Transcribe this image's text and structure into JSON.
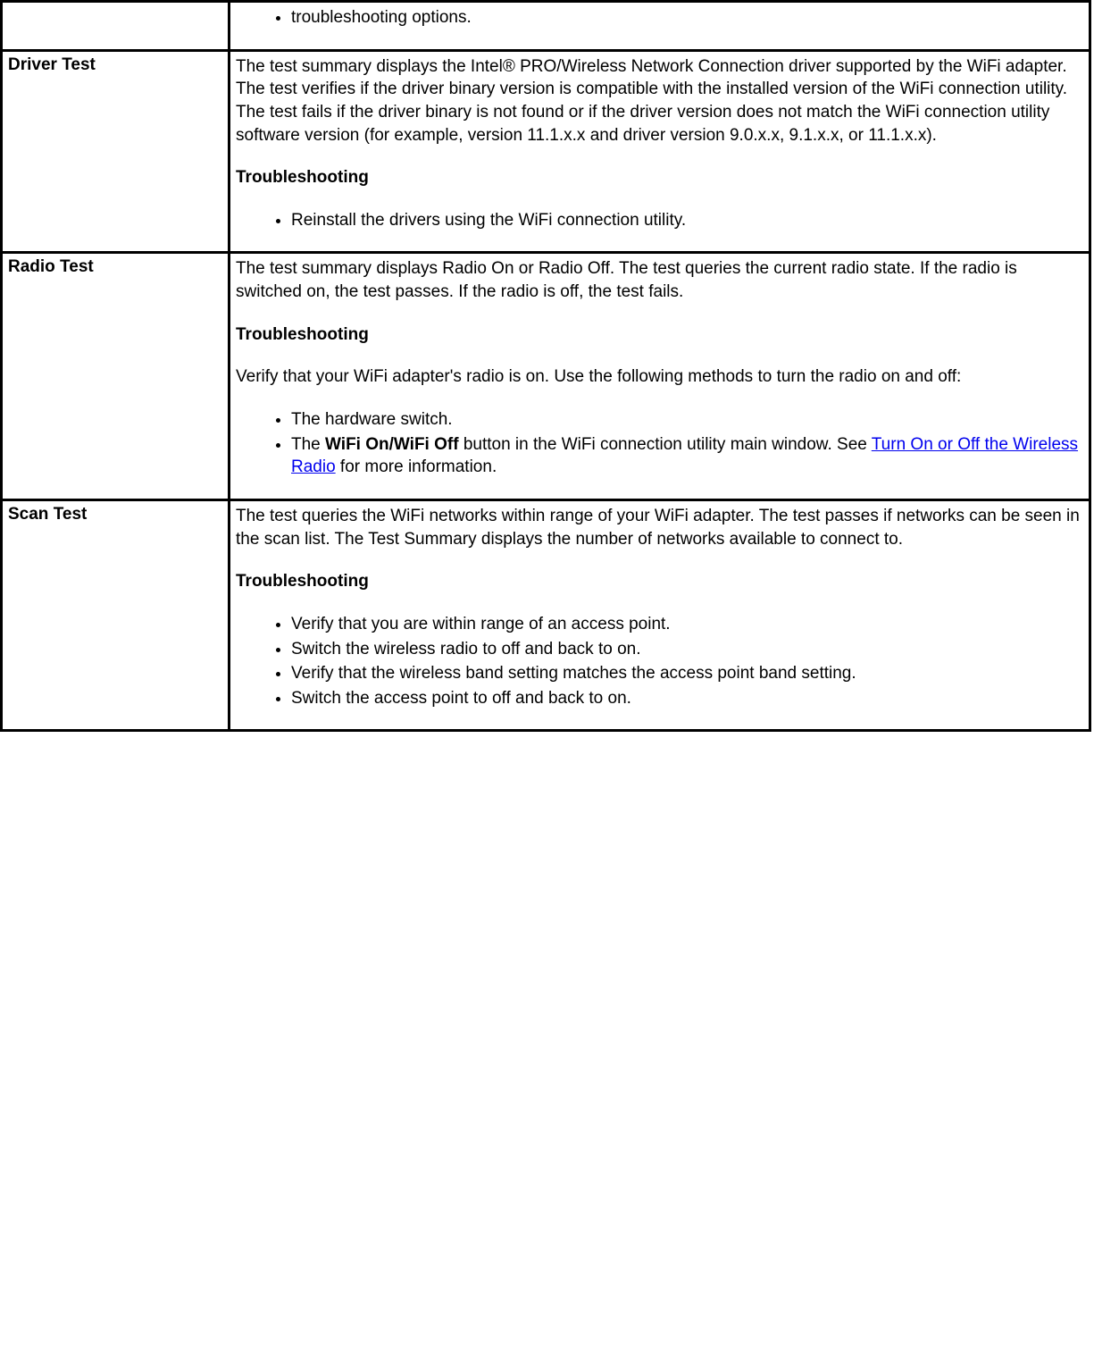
{
  "row0": {
    "label": "",
    "bullet": "troubleshooting options."
  },
  "row1": {
    "label": "Driver Test",
    "desc": "The test summary displays the Intel® PRO/Wireless Network Connection driver supported by the WiFi adapter. The test verifies if the driver binary version is compatible with the installed version of the WiFi connection utility. The test fails if the driver binary is not found or if the driver version does not match the WiFi connection utility software version (for example, version 11.1.x.x and driver version 9.0.x.x, 9.1.x.x, or 11.1.x.x).",
    "heading": "Troubleshooting",
    "bullet1": "Reinstall the drivers using the WiFi connection utility."
  },
  "row2": {
    "label": "Radio Test",
    "desc": "The test summary displays Radio On or Radio Off. The test queries the current radio state. If the radio is switched on, the test passes. If the radio is off, the test fails.",
    "heading": "Troubleshooting",
    "desc2": "Verify that your WiFi adapter's radio is on. Use the following methods to turn the radio on and off:",
    "bullet1": "The hardware switch.",
    "bullet2_pre": "The ",
    "bullet2_bold": "WiFi On/WiFi Off",
    "bullet2_mid": " button in the WiFi connection utility main window. See ",
    "bullet2_link": "Turn On or Off the Wireless Radio",
    "bullet2_post": " for more information."
  },
  "row3": {
    "label": "Scan Test",
    "desc": "The test queries the WiFi networks within range of your WiFi adapter. The test passes if networks can be seen in the scan list. The Test Summary displays the number of networks available to connect to.",
    "heading": "Troubleshooting",
    "bullet1": "Verify that you are within range of an access point.",
    "bullet2": "Switch the wireless radio to off and back to on.",
    "bullet3": "Verify that the wireless band setting matches the access point band setting.",
    "bullet4": "Switch the access point to off and back to on."
  }
}
